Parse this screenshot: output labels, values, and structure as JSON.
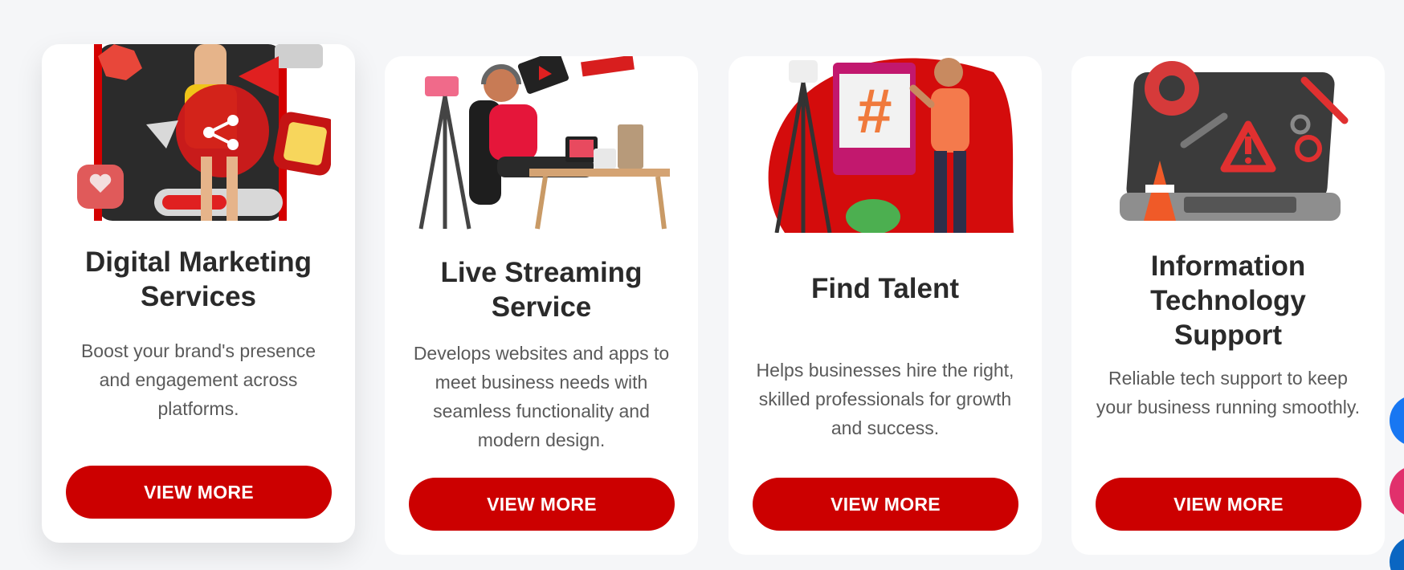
{
  "cards": [
    {
      "title": "Digital Marketing Services",
      "description": "Boost your brand's presence and engagement across platforms.",
      "button_label": "VIEW MORE",
      "art_icon": "social-share-phone-illustration"
    },
    {
      "title": "Live Streaming Service",
      "description": "Develops websites and apps to meet business needs with seamless functionality and modern design.",
      "button_label": "VIEW MORE",
      "art_icon": "streamer-desk-illustration"
    },
    {
      "title": "Find Talent",
      "description": "Helps businesses hire the right, skilled professionals for growth and success.",
      "button_label": "VIEW MORE",
      "art_icon": "hashtag-presenter-illustration"
    },
    {
      "title": "Information Technology Support",
      "description": "Reliable tech support to keep your business running smoothly.",
      "button_label": "VIEW MORE",
      "art_icon": "laptop-warning-tools-illustration"
    }
  ],
  "floating_buttons": [
    {
      "icon": "blue-circle-icon",
      "color": "#1877f2"
    },
    {
      "icon": "pink-circle-icon",
      "color": "#e1306c"
    },
    {
      "icon": "blue-circle-icon",
      "color": "#0a66c2"
    }
  ],
  "colors": {
    "accent": "#cc0000",
    "page_background": "#f5f6f8",
    "card_background": "#ffffff",
    "title_text": "#2a2a2a",
    "body_text": "#5a5a5a"
  }
}
